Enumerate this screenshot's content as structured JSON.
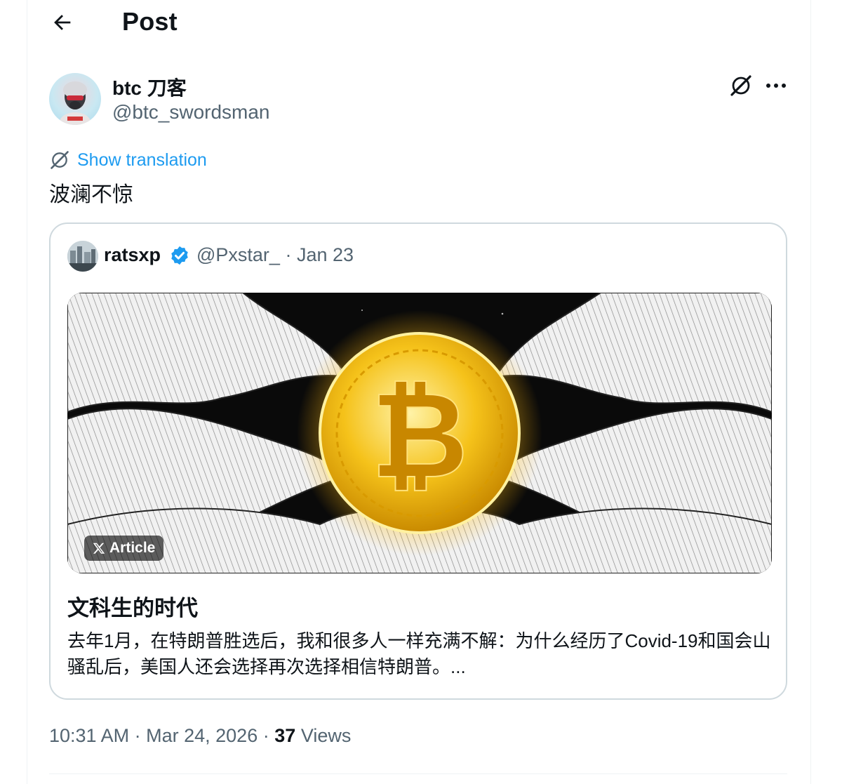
{
  "header": {
    "title": "Post"
  },
  "author": {
    "display_name": "btc 刀客",
    "handle": "@btc_swordsman"
  },
  "translation": {
    "label": "Show translation"
  },
  "post": {
    "text": "波澜不惊"
  },
  "quote": {
    "name": "ratsxp",
    "handle": "@Pxstar_",
    "separator": "·",
    "date": "Jan 23",
    "badge": {
      "icon": "x-logo-icon",
      "label": "Article"
    },
    "title": "文科生的时代",
    "body": "去年1月，在特朗普胜选后，我和很多人一样充满不解：为什么经历了Covid-19和国会山骚乱后，美国人还会选择再次选择相信特朗普。..."
  },
  "meta": {
    "time": "10:31 AM",
    "separator": "·",
    "date": "Mar 24, 2026",
    "views_count": "37",
    "views_label": "Views"
  },
  "colors": {
    "accent": "#1d9bf0",
    "muted": "#536471",
    "border": "#cfd9de",
    "coin": "#f2b705"
  }
}
